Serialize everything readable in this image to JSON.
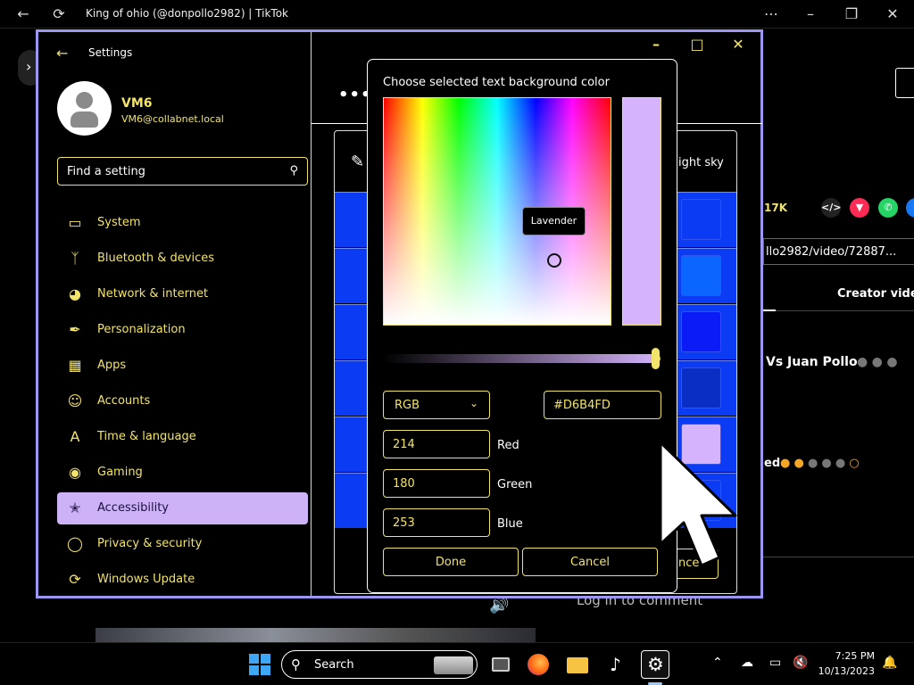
{
  "browser": {
    "title": "King of ohio (@donpollo2982) | TikTok"
  },
  "tiktok": {
    "count": "17K",
    "url": "llo2982/video/72887...",
    "tab": "Creator video",
    "caption": "Vs Juan Pollo",
    "comment_fragment": "ed",
    "login": "Log in to comment"
  },
  "settings": {
    "app_title": "Settings",
    "user": {
      "name": "VM6",
      "email": "VM6@collabnet.local"
    },
    "search_placeholder": "Find a setting",
    "nav": [
      {
        "label": "System",
        "icon": "monitor-icon"
      },
      {
        "label": "Bluetooth & devices",
        "icon": "bluetooth-icon"
      },
      {
        "label": "Network & internet",
        "icon": "wifi-icon"
      },
      {
        "label": "Personalization",
        "icon": "brush-icon"
      },
      {
        "label": "Apps",
        "icon": "apps-icon"
      },
      {
        "label": "Accounts",
        "icon": "person-icon"
      },
      {
        "label": "Time & language",
        "icon": "language-icon"
      },
      {
        "label": "Gaming",
        "icon": "gamepad-icon"
      },
      {
        "label": "Accessibility",
        "icon": "accessibility-icon",
        "selected": true
      },
      {
        "label": "Privacy & security",
        "icon": "shield-icon"
      },
      {
        "label": "Windows Update",
        "icon": "update-icon"
      }
    ],
    "theme_label_fragment": "ight sky",
    "theme_cancel_fragment": "nce",
    "theme_swatch_colors": [
      "#0b3bf3",
      "#0a66ff",
      "#0a1bf5",
      "#0a2ec4",
      "#d6b4fd",
      "#0b3bf3"
    ]
  },
  "color_dialog": {
    "title": "Choose selected text background color",
    "tooltip": "Lavender",
    "mode": "RGB",
    "hex": "#D6B4FD",
    "selected_color": "#D6B4FD",
    "channels": [
      {
        "label": "Red",
        "value": "214"
      },
      {
        "label": "Green",
        "value": "180"
      },
      {
        "label": "Blue",
        "value": "253"
      }
    ],
    "done_label": "Done",
    "cancel_label": "Cancel"
  },
  "taskbar": {
    "search_label": "Search",
    "time": "7:25 PM",
    "date": "10/13/2023"
  },
  "colors": {
    "accent_text": "#f2e36b",
    "selection": "#cdb2f7",
    "window_border": "#9d96f2"
  }
}
